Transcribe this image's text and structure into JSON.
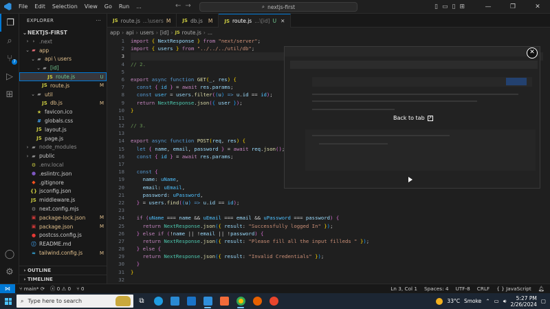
{
  "titlebar": {
    "menu": [
      "File",
      "Edit",
      "Selection",
      "View",
      "Go",
      "Run",
      "..."
    ],
    "command_center": "nextjs-first"
  },
  "sidebar": {
    "header": "EXPLORER",
    "root": "NEXTJS-FIRST",
    "tree": [
      {
        "name": ".next",
        "depth": 1,
        "chev": "›",
        "icon": "›",
        "icon_color": "#8c8c8c",
        "status": "",
        "status_color": "#cccccc",
        "color": "#8c8c8c"
      },
      {
        "name": "app",
        "depth": 1,
        "chev": "⌄",
        "icon": "▰",
        "icon_color": "#e06c75",
        "status": "",
        "status_color": "#e2c08d",
        "color": "#e2c08d"
      },
      {
        "name": "api \\ users",
        "depth": 2,
        "chev": "⌄",
        "icon": "▰",
        "icon_color": "#8c8c8c",
        "status": "",
        "status_color": "#e2c08d",
        "color": "#e2c08d"
      },
      {
        "name": "[id]",
        "depth": 3,
        "chev": "⌄",
        "icon": "▰",
        "icon_color": "#8c8c8c",
        "status": "",
        "status_color": "#73c991",
        "color": "#73c991"
      },
      {
        "name": "route.js",
        "depth": 4,
        "chev": "",
        "icon": "JS",
        "icon_color": "#cbcb41",
        "status": "U",
        "status_color": "#73c991",
        "color": "#73c991",
        "selected": true
      },
      {
        "name": "route.js",
        "depth": 3,
        "chev": "",
        "icon": "JS",
        "icon_color": "#cbcb41",
        "status": "M",
        "status_color": "#e2c08d",
        "color": "#e2c08d"
      },
      {
        "name": "util",
        "depth": 2,
        "chev": "⌄",
        "icon": "▰",
        "icon_color": "#8c8c8c",
        "status": "",
        "status_color": "#e2c08d",
        "color": "#e2c08d"
      },
      {
        "name": "db.js",
        "depth": 3,
        "chev": "",
        "icon": "JS",
        "icon_color": "#cbcb41",
        "status": "M",
        "status_color": "#e2c08d",
        "color": "#e2c08d"
      },
      {
        "name": "favicon.ico",
        "depth": 2,
        "chev": "",
        "icon": "★",
        "icon_color": "#cbcb41",
        "status": "",
        "status_color": "#cccccc",
        "color": "#cccccc"
      },
      {
        "name": "globals.css",
        "depth": 2,
        "chev": "",
        "icon": "#",
        "icon_color": "#42a5f5",
        "status": "",
        "status_color": "#cccccc",
        "color": "#cccccc"
      },
      {
        "name": "layout.js",
        "depth": 2,
        "chev": "",
        "icon": "JS",
        "icon_color": "#cbcb41",
        "status": "",
        "status_color": "#cccccc",
        "color": "#cccccc"
      },
      {
        "name": "page.js",
        "depth": 2,
        "chev": "",
        "icon": "JS",
        "icon_color": "#cbcb41",
        "status": "",
        "status_color": "#cccccc",
        "color": "#cccccc"
      },
      {
        "name": "node_modules",
        "depth": 1,
        "chev": "›",
        "icon": "▰",
        "icon_color": "#8c8c8c",
        "status": "",
        "status_color": "#cccccc",
        "color": "#8c8c8c"
      },
      {
        "name": "public",
        "depth": 1,
        "chev": "›",
        "icon": "▰",
        "icon_color": "#8c8c8c",
        "status": "",
        "status_color": "#cccccc",
        "color": "#cccccc"
      },
      {
        "name": ".env.local",
        "depth": 1,
        "chev": "",
        "icon": "⚙",
        "icon_color": "#cbcb41",
        "status": "",
        "status_color": "#cccccc",
        "color": "#8c8c8c"
      },
      {
        "name": ".eslintrc.json",
        "depth": 1,
        "chev": "",
        "icon": "●",
        "icon_color": "#7e57c2",
        "status": "",
        "status_color": "#cccccc",
        "color": "#cccccc"
      },
      {
        "name": ".gitignore",
        "depth": 1,
        "chev": "",
        "icon": "◆",
        "icon_color": "#f4511e",
        "status": "",
        "status_color": "#cccccc",
        "color": "#cccccc"
      },
      {
        "name": "jsconfig.json",
        "depth": 1,
        "chev": "",
        "icon": "{}",
        "icon_color": "#cbcb41",
        "status": "",
        "status_color": "#cccccc",
        "color": "#cccccc"
      },
      {
        "name": "middleware.js",
        "depth": 1,
        "chev": "",
        "icon": "JS",
        "icon_color": "#cbcb41",
        "status": "",
        "status_color": "#cccccc",
        "color": "#cccccc"
      },
      {
        "name": "next.config.mjs",
        "depth": 1,
        "chev": "",
        "icon": "⚙",
        "icon_color": "#8c8c8c",
        "status": "",
        "status_color": "#cccccc",
        "color": "#cccccc"
      },
      {
        "name": "package-lock.json",
        "depth": 1,
        "chev": "",
        "icon": "▣",
        "icon_color": "#cb3837",
        "status": "M",
        "status_color": "#e2c08d",
        "color": "#e2c08d"
      },
      {
        "name": "package.json",
        "depth": 1,
        "chev": "",
        "icon": "▣",
        "icon_color": "#cb3837",
        "status": "M",
        "status_color": "#e2c08d",
        "color": "#e2c08d"
      },
      {
        "name": "postcss.config.js",
        "depth": 1,
        "chev": "",
        "icon": "●",
        "icon_color": "#e53935",
        "status": "",
        "status_color": "#cccccc",
        "color": "#cccccc"
      },
      {
        "name": "README.md",
        "depth": 1,
        "chev": "",
        "icon": "ⓘ",
        "icon_color": "#42a5f5",
        "status": "",
        "status_color": "#cccccc",
        "color": "#cccccc"
      },
      {
        "name": "tailwind.config.js",
        "depth": 1,
        "chev": "",
        "icon": "≈",
        "icon_color": "#38bdf8",
        "status": "M",
        "status_color": "#e2c08d",
        "color": "#e2c08d"
      }
    ],
    "outline": "OUTLINE",
    "timeline": "TIMELINE"
  },
  "tabs": [
    {
      "label": "route.js",
      "sub": "...\\users",
      "status": "M",
      "status_kind": "mod",
      "active": false
    },
    {
      "label": "db.js",
      "sub": "",
      "status": "M",
      "status_kind": "mod",
      "active": false
    },
    {
      "label": "route.js",
      "sub": "...\\[id]",
      "status": "U",
      "status_kind": "unt",
      "active": true
    }
  ],
  "breadcrumb": [
    "app",
    "api",
    "users",
    "[id]",
    "route.js",
    "..."
  ],
  "editor": {
    "current_line": 3,
    "lines": [
      "<span class=\"kc\">import</span> <span class=\"p1\">{</span> <span class=\"var\">NextResponse</span> <span class=\"p1\">}</span> <span class=\"kc\">from</span> <span class=\"str\">\"next/server\"</span>;",
      "<span class=\"kc\">import</span> <span class=\"p1\">{</span> <span class=\"var\">users</span> <span class=\"p1\">}</span> <span class=\"kc\">from</span> <span class=\"str\">\"../../../util/db\"</span>;",
      "",
      "<span class=\"cmt\">// 2.</span>",
      "",
      "<span class=\"kc\">export</span> <span class=\"kw\">async</span> <span class=\"kw\">function</span> <span class=\"fn\">GET</span><span class=\"p1\">(</span><span class=\"var\">_</span>, <span class=\"var\">res</span><span class=\"p1\">)</span> <span class=\"p1\">{</span>",
      "  <span class=\"kw\">const</span> <span class=\"p2\">{</span> <span class=\"cst\">id</span> <span class=\"p2\">}</span> = <span class=\"kc\">await</span> <span class=\"var\">res</span>.<span class=\"var\">params</span>;",
      "  <span class=\"kw\">const</span> <span class=\"cst\">user</span> = <span class=\"var\">users</span>.<span class=\"fn\">filter</span><span class=\"p2\">(</span><span class=\"p3\">(</span><span class=\"var\">u</span><span class=\"p3\">)</span> <span class=\"kw\">=&gt;</span> <span class=\"var\">u</span>.<span class=\"var\">id</span> == <span class=\"cst\">id</span><span class=\"p2\">)</span>;",
      "  <span class=\"kc\">return</span> <span class=\"cls\">NextResponse</span>.<span class=\"fn\">json</span><span class=\"p2\">(</span><span class=\"p3\">{</span> <span class=\"var\">user</span> <span class=\"p3\">}</span><span class=\"p2\">)</span>;",
      "<span class=\"p1\">}</span>",
      "",
      "<span class=\"cmt\">// 3.</span>",
      "",
      "<span class=\"kc\">export</span> <span class=\"kw\">async</span> <span class=\"kw\">function</span> <span class=\"fn\">POST</span><span class=\"p1\">(</span><span class=\"var\">req</span>, <span class=\"var\">res</span><span class=\"p1\">)</span> <span class=\"p1\">{</span>",
      "  <span class=\"kw\">let</span> <span class=\"p2\">{</span> <span class=\"var\">name</span>, <span class=\"var\">email</span>, <span class=\"var\">password</span> <span class=\"p2\">}</span> = <span class=\"kc\">await</span> <span class=\"var\">req</span>.<span class=\"fn\">json</span><span class=\"p2\">(</span><span class=\"p2\">)</span>;",
      "  <span class=\"kw\">const</span> <span class=\"p2\">{</span> <span class=\"cst\">id</span> <span class=\"p2\">}</span> = <span class=\"kc\">await</span> <span class=\"var\">res</span>.<span class=\"var\">params</span>;",
      "",
      "  <span class=\"kw\">const</span> <span class=\"p2\">{</span>",
      "    <span class=\"var\">name</span>: <span class=\"cst\">uName</span>,",
      "    <span class=\"var\">email</span>: <span class=\"cst\">uEmail</span>,",
      "    <span class=\"var\">password</span>: <span class=\"cst\">uPassword</span>,",
      "  <span class=\"p2\">}</span> = <span class=\"var\">users</span>.<span class=\"fn\">find</span><span class=\"p2\">(</span><span class=\"p3\">(</span><span class=\"var\">u</span><span class=\"p3\">)</span> <span class=\"kw\">=&gt;</span> <span class=\"var\">u</span>.<span class=\"var\">id</span> == <span class=\"cst\">id</span><span class=\"p2\">)</span>;",
      "",
      "  <span class=\"kc\">if</span> <span class=\"p2\">(</span><span class=\"cst\">uName</span> === <span class=\"var\">name</span> &amp;&amp; <span class=\"cst\">uEmail</span> === <span class=\"var\">email</span> &amp;&amp; <span class=\"cst\">uPassword</span> === <span class=\"var\">password</span><span class=\"p2\">)</span> <span class=\"p2\">{</span>",
      "    <span class=\"kc\">return</span> <span class=\"cls\">NextResponse</span>.<span class=\"fn\">json</span><span class=\"p3\">(</span><span class=\"p1\">{</span> <span class=\"var\">result</span>: <span class=\"str\">\"Successfully logged In\"</span> <span class=\"p1\">}</span><span class=\"p3\">)</span>;",
      "  <span class=\"p2\">}</span> <span class=\"kc\">else if</span> <span class=\"p2\">(</span>!<span class=\"var\">name</span> || !<span class=\"var\">email</span> || !<span class=\"var\">password</span><span class=\"p2\">)</span> <span class=\"p2\">{</span>",
      "    <span class=\"kc\">return</span> <span class=\"cls\">NextResponse</span>.<span class=\"fn\">json</span><span class=\"p3\">(</span><span class=\"p1\">{</span> <span class=\"var\">result</span>: <span class=\"str\">\"Please fill all the input filleds \"</span> <span class=\"p1\">}</span><span class=\"p3\">)</span>;",
      "  <span class=\"p2\">}</span> <span class=\"kc\">else</span> <span class=\"p2\">{</span>",
      "    <span class=\"kc\">return</span> <span class=\"cls\">NextResponse</span>.<span class=\"fn\">json</span><span class=\"p3\">(</span><span class=\"p1\">{</span> <span class=\"var\">result</span>: <span class=\"str\">\"Invalid Credentials\"</span> <span class=\"p1\">}</span><span class=\"p3\">)</span>;",
      "  <span class=\"p2\">}</span>",
      "<span class=\"p1\">}</span>",
      ""
    ]
  },
  "overlay": {
    "back_to_tab": "Back to tab"
  },
  "statusbar": {
    "branch": "main*",
    "errors": "0",
    "warnings": "0",
    "ports": "0",
    "position": "Ln 3, Col 1",
    "spaces": "Spaces: 4",
    "encoding": "UTF-8",
    "eol": "CRLF",
    "language": "JavaScript"
  },
  "taskbar": {
    "search_placeholder": "Type here to search",
    "weather_temp": "33°C",
    "weather_desc": "Smoke",
    "time": "5:27 PM",
    "date": "2/26/2024"
  },
  "colors": {
    "accent": "#0078d4",
    "modified": "#e2c08d",
    "untracked": "#73c991"
  }
}
